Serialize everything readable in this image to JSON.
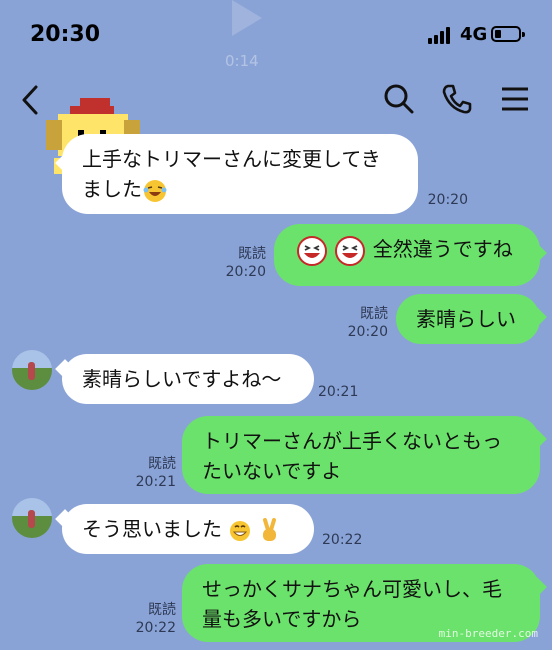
{
  "status": {
    "time": "20:30",
    "network": "4G"
  },
  "ghost": {
    "time": "0:14"
  },
  "messages": [
    {
      "dir": "in",
      "text1": "上手なトリマーさんに変更してき",
      "text2": "ました",
      "time": "20:20"
    },
    {
      "dir": "out",
      "text": "全然違うですね",
      "read": "既読",
      "time": "20:20"
    },
    {
      "dir": "out",
      "text": "素晴らしい",
      "read": "既読",
      "time": "20:20"
    },
    {
      "dir": "in",
      "text": "素晴らしいですよね〜",
      "time": "20:21"
    },
    {
      "dir": "out",
      "text1": "トリマーさんが上手くないともっ",
      "text2": "たいないですよ",
      "read": "既読",
      "time": "20:21"
    },
    {
      "dir": "in",
      "text": "そう思いました",
      "time": "20:22"
    },
    {
      "dir": "out",
      "text1": "せっかくサナちゃん可愛いし、毛",
      "text2": "量も多いですから",
      "read": "既読",
      "time": "20:22"
    }
  ],
  "watermark": "min-breeder.com",
  "icons": [
    "back-icon",
    "search-icon",
    "phone-icon",
    "menu-icon"
  ],
  "colors": {
    "background": "#8aa3d6",
    "outgoing": "#6be26b",
    "incoming": "#ffffff"
  }
}
